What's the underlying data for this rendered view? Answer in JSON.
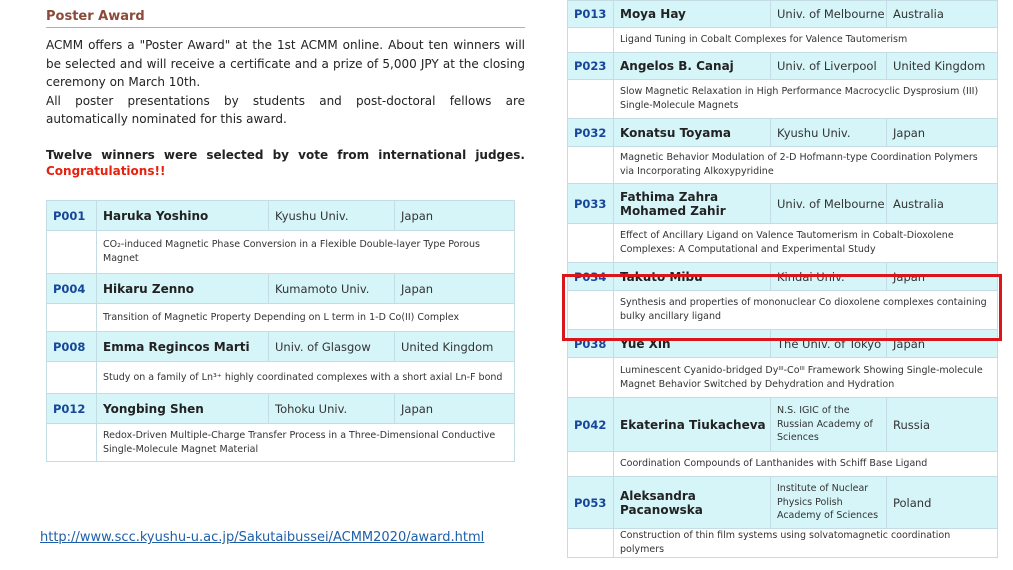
{
  "section": {
    "title": "Poster Award",
    "intro_1": "ACMM offers a \"Poster Award\" at the 1st ACMM online. About ten winners will be selected and will receive a certificate and a prize of 5,000 JPY at the closing ceremony on March 10th.",
    "intro_2": "All poster presentations by students and post-doctoral fellows are automatically nominated for this award.",
    "winners_note": "Twelve winners were selected by vote from international judges.",
    "congrats": "Congratulations!!"
  },
  "left_winners": [
    {
      "id": "P001",
      "name": "Haruka Yoshino",
      "univ": "Kyushu Univ.",
      "country": "Japan",
      "title": "CO₂-induced Magnetic Phase Conversion in a Flexible Double-layer Type Porous Magnet"
    },
    {
      "id": "P004",
      "name": "Hikaru Zenno",
      "univ": "Kumamoto Univ.",
      "country": "Japan",
      "title": "Transition of Magnetic Property Depending on L term in 1-D Co(II) Complex"
    },
    {
      "id": "P008",
      "name": "Emma Regincos Marti",
      "univ": "Univ. of Glasgow",
      "country": "United Kingdom",
      "title": "Study on a family of Ln³⁺ highly coordinated complexes with a short axial Ln-F bond"
    },
    {
      "id": "P012",
      "name": "Yongbing Shen",
      "univ": "Tohoku Univ.",
      "country": "Japan",
      "title": "Redox-Driven Multiple-Charge Transfer Process in a Three-Dimensional Conductive Single-Molecule Magnet Material"
    }
  ],
  "right_winners": [
    {
      "id": "P013",
      "name": "Moya Hay",
      "univ": "Univ. of Melbourne",
      "country": "Australia",
      "title": "Ligand Tuning in Cobalt Complexes for Valence Tautomerism"
    },
    {
      "id": "P023",
      "name": "Angelos B. Canaj",
      "univ": "Univ. of Liverpool",
      "country": "United Kingdom",
      "title": "Slow Magnetic Relaxation in High Performance Macrocyclic Dysprosium (III) Single-Molecule Magnets"
    },
    {
      "id": "P032",
      "name": "Konatsu Toyama",
      "univ": "Kyushu Univ.",
      "country": "Japan",
      "title": "Magnetic Behavior Modulation of 2-D Hofmann-type Coordination Polymers via Incorporating Alkoxypyridine"
    },
    {
      "id": "P033",
      "name": "Fathima Zahra Mohamed Zahir",
      "univ": "Univ. of Melbourne",
      "country": "Australia",
      "title": "Effect of Ancillary Ligand on Valence Tautomerism in Cobalt-Dioxolene Complexes: A Computational and Experimental Study"
    },
    {
      "id": "P034",
      "name": "Takuto Mibu",
      "univ": "Kindai Univ.",
      "country": "Japan",
      "title": "Synthesis and properties of mononuclear Co dioxolene complexes containing bulky ancillary ligand"
    },
    {
      "id": "P038",
      "name": "Yue Xin",
      "univ": "The Univ. of Tokyo",
      "country": "Japan",
      "title": "Luminescent Cyanido-bridged Dyᴵᴵᴵ-Coᴵᴵᴵ Framework Showing Single-molecule Magnet Behavior Switched by Dehydration and Hydration"
    },
    {
      "id": "P042",
      "name": "Ekaterina Tiukacheva",
      "univ": "N.S. IGIC of the Russian Academy of Sciences",
      "country": "Russia",
      "title": "Coordination Compounds of Lanthanides with Schiff Base Ligand"
    },
    {
      "id": "P053",
      "name": "Aleksandra Pacanowska",
      "univ": "Institute of Nuclear Physics Polish Academy of Sciences",
      "country": "Poland",
      "title": "Construction of thin film systems using solvatomagnetic coordination polymers"
    }
  ],
  "footer": {
    "url": "http://www.scc.kyushu-u.ac.jp/Sakutaibussei/ACMM2020/award.html"
  },
  "colors": {
    "header_bg": "#d6f5f8",
    "id_text": "#16479a",
    "section_title": "#8b4a3a",
    "congrats": "#e8200c",
    "highlight": "#d9161c",
    "link": "#1f5fa8"
  }
}
